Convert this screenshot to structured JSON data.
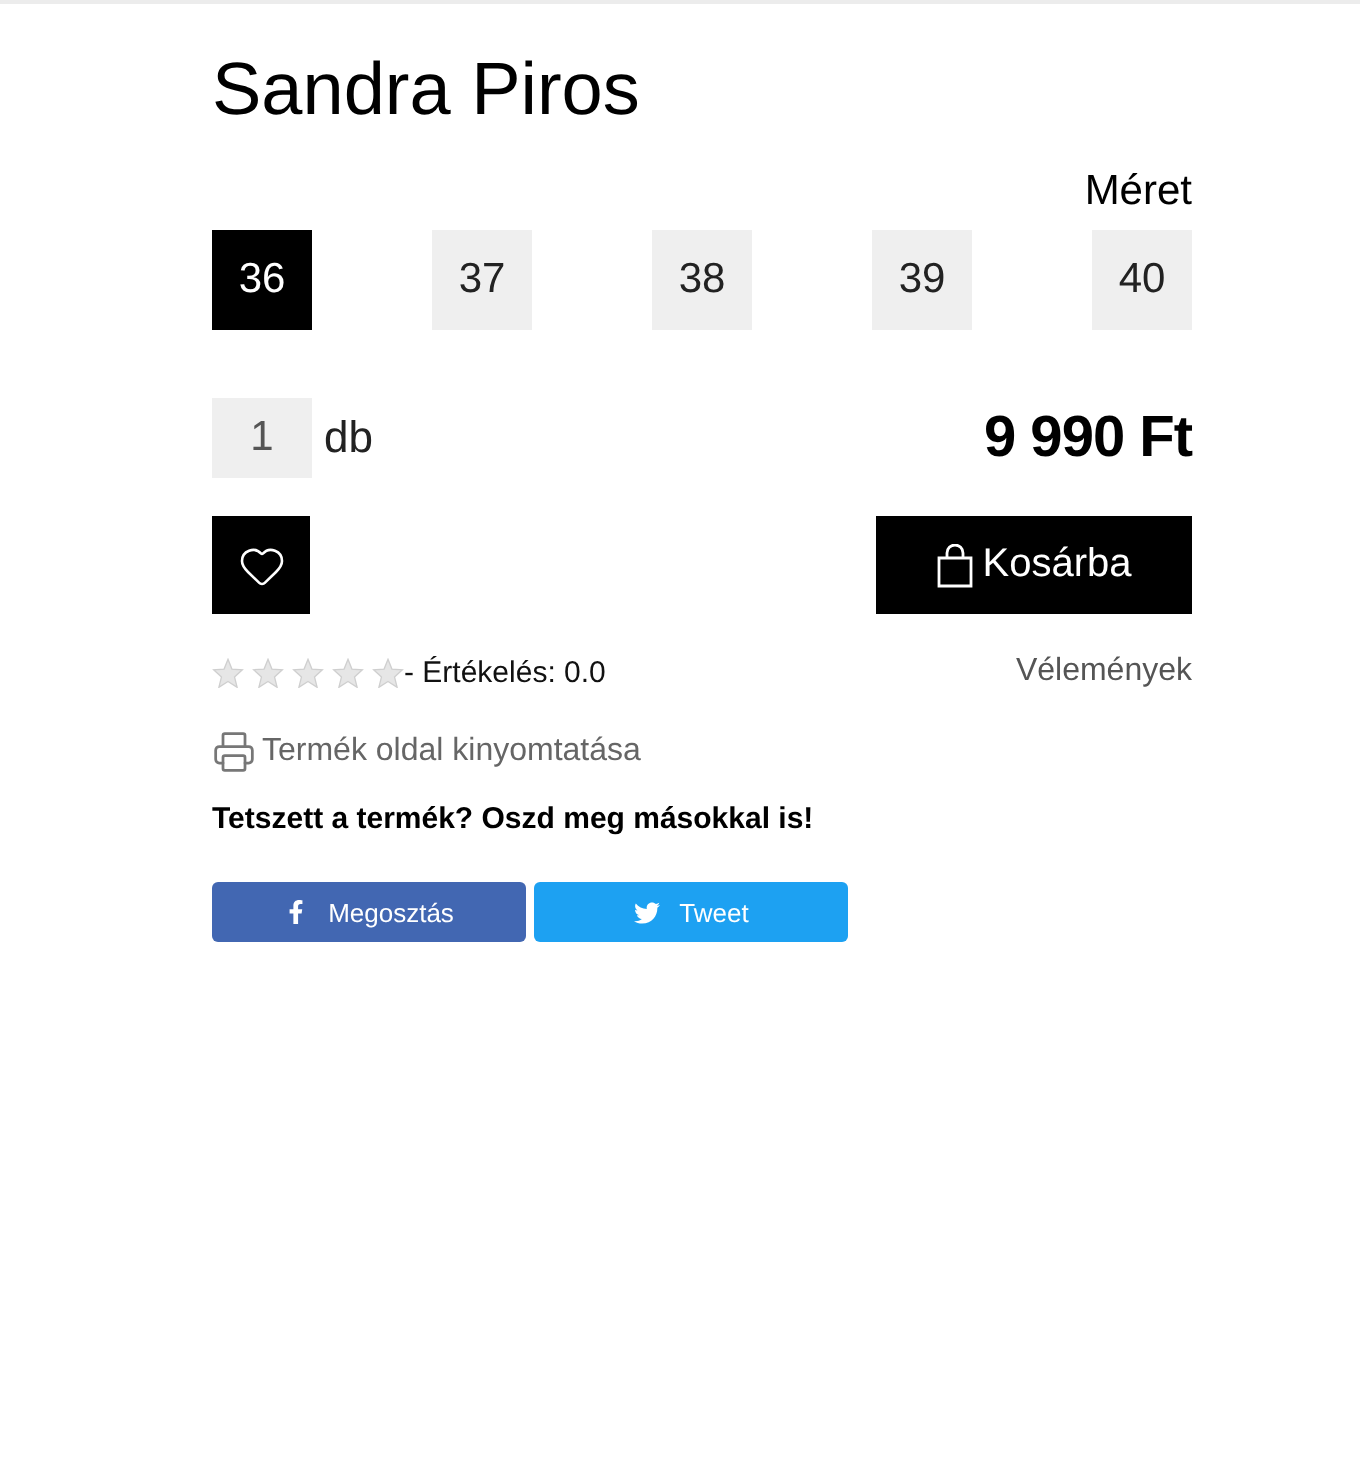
{
  "product": {
    "title": "Sandra Piros"
  },
  "sizes": {
    "label": "Méret",
    "options": [
      {
        "label": "36",
        "selected": true
      },
      {
        "label": "37",
        "selected": false
      },
      {
        "label": "38",
        "selected": false
      },
      {
        "label": "39",
        "selected": false
      },
      {
        "label": "40",
        "selected": false
      }
    ]
  },
  "quantity": {
    "value": "1",
    "unit": "db"
  },
  "price": "9 990 Ft",
  "cart_button": {
    "label": "Kosárba"
  },
  "rating": {
    "stars": 0,
    "text": "- Értékelés: 0.0",
    "reviews_link": "Vélemények"
  },
  "print_link": {
    "label": "Termék oldal kinyomtatása"
  },
  "share": {
    "heading": "Tetszett a termék? Oszd meg másokkal is!",
    "buttons": [
      {
        "kind": "facebook",
        "label": "Megosztás"
      },
      {
        "kind": "twitter",
        "label": "Tweet"
      }
    ]
  }
}
